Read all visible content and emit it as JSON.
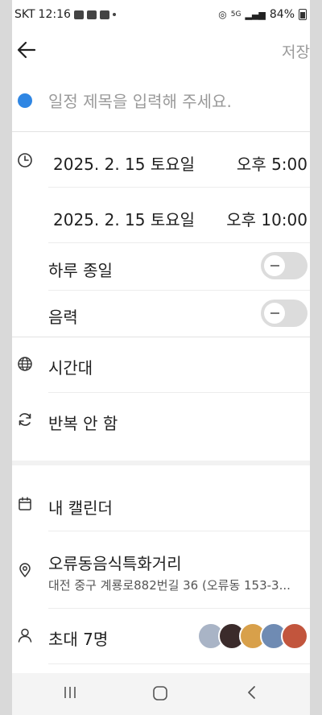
{
  "status": {
    "carrier": "SKT",
    "time": "12:16",
    "net": "5G",
    "battery": "84%"
  },
  "header": {
    "save_label": "저장"
  },
  "event": {
    "title_placeholder": "일정 제목을 입력해 주세요.",
    "title_value": "",
    "color": "#2f86e3"
  },
  "schedule": {
    "start_date": "2025. 2. 15 토요일",
    "start_time": "오후 5:00",
    "end_date": "2025. 2. 15 토요일",
    "end_time": "오후 10:00",
    "all_day_label": "하루 종일",
    "all_day_on": false,
    "lunar_label": "음력",
    "lunar_on": false,
    "timezone_label": "시간대",
    "repeat_label": "반복 안 함"
  },
  "calendar": {
    "name": "내 캘린더"
  },
  "location": {
    "name": "오류동음식특화거리",
    "address": "대전 중구 계룡로882번길 36 (오류동 153-3..."
  },
  "invite": {
    "label": "초대 7명",
    "avatar_colors": [
      "#a9b4c6",
      "#3b2b2b",
      "#d8a04a",
      "#6f8bb3",
      "#c2553d"
    ]
  }
}
